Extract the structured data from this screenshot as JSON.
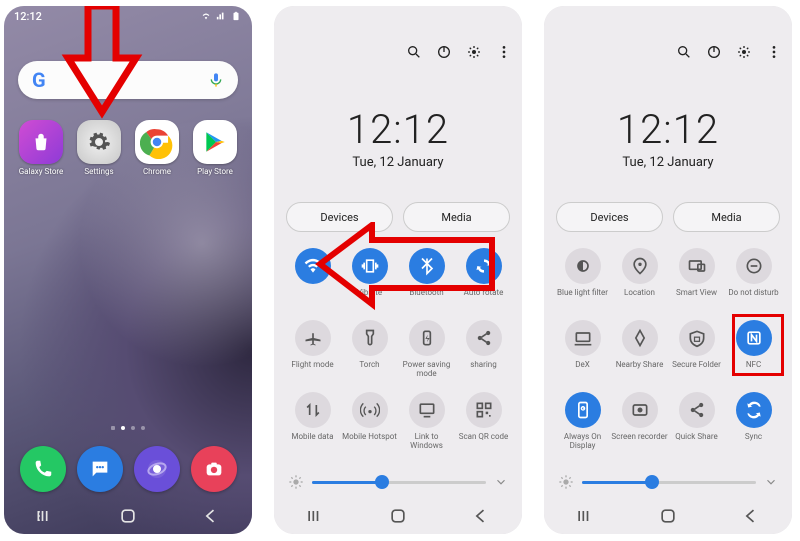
{
  "status_time": "12:12",
  "home_apps": [
    {
      "name": "galaxy-store",
      "label": "Galaxy Store"
    },
    {
      "name": "settings",
      "label": "Settings"
    },
    {
      "name": "chrome",
      "label": "Chrome"
    },
    {
      "name": "play-store",
      "label": "Play Store"
    }
  ],
  "panel": {
    "time": "12:12",
    "date": "Tue, 12 January",
    "devices_label": "Devices",
    "media_label": "Media"
  },
  "tiles2": [
    {
      "name": "wifi",
      "label": "",
      "active": true
    },
    {
      "name": "vibrate",
      "label": "Vibrate",
      "active": true
    },
    {
      "name": "bluetooth",
      "label": "Bluetooth",
      "active": true
    },
    {
      "name": "autorotate",
      "label": "Auto rotate",
      "active": true
    },
    {
      "name": "flight",
      "label": "Flight mode",
      "active": false
    },
    {
      "name": "torch",
      "label": "Torch",
      "active": false
    },
    {
      "name": "powersave",
      "label": "Power saving mode",
      "active": false
    },
    {
      "name": "sharing",
      "label": "sharing",
      "active": false
    },
    {
      "name": "mobiledata",
      "label": "Mobile data",
      "active": false
    },
    {
      "name": "hotspot",
      "label": "Mobile Hotspot",
      "active": false
    },
    {
      "name": "linkwin",
      "label": "Link to Windows",
      "active": false
    },
    {
      "name": "qrscan",
      "label": "Scan QR code",
      "active": false
    }
  ],
  "tiles3": [
    {
      "name": "bluelight",
      "label": "Blue light filter",
      "active": false
    },
    {
      "name": "location",
      "label": "Location",
      "active": false
    },
    {
      "name": "smartview",
      "label": "Smart View",
      "active": false
    },
    {
      "name": "dnd",
      "label": "Do not disturb",
      "active": false
    },
    {
      "name": "dex",
      "label": "DeX",
      "active": false
    },
    {
      "name": "nearby",
      "label": "Nearby Share",
      "active": false
    },
    {
      "name": "securefolder",
      "label": "Secure Folder",
      "active": false
    },
    {
      "name": "nfc",
      "label": "NFC",
      "active": true
    },
    {
      "name": "aod",
      "label": "Always On Display",
      "active": true
    },
    {
      "name": "screenrec",
      "label": "Screen recorder",
      "active": false
    },
    {
      "name": "quickshare",
      "label": "Quick Share",
      "active": false
    },
    {
      "name": "sync",
      "label": "Sync",
      "active": true
    }
  ]
}
